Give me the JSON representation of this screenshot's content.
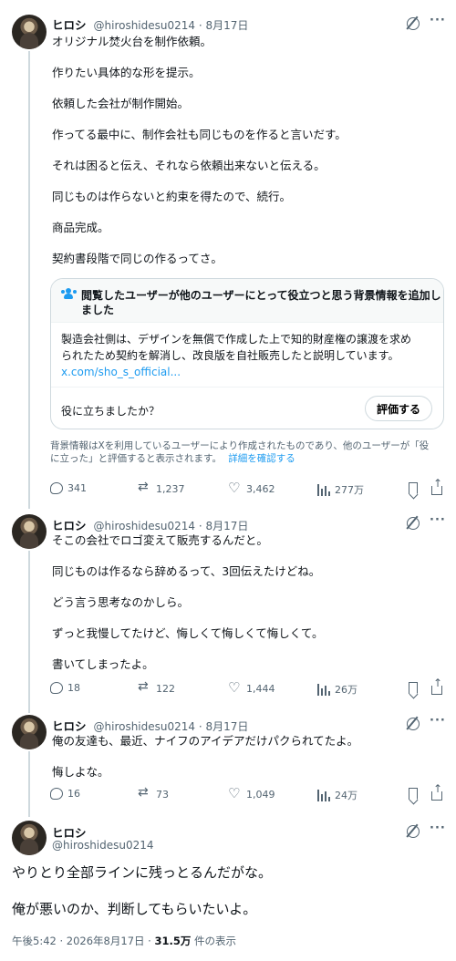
{
  "user": {
    "name": "ヒロシ",
    "handle": "@hiroshidesu0214",
    "sep": "·"
  },
  "tweet1": {
    "date": "8月17日",
    "lines": [
      "オリジナル焚火台を制作依頼。",
      "作りたい具体的な形を提示。",
      "依頼した会社が制作開始。",
      "作ってる最中に、制作会社も同じものを作ると言いだす。",
      "それは困ると伝え、それなら依頼出来ないと伝える。",
      "同じものは作らないと約束を得たので、続行。",
      "商品完成。",
      "契約書段階で同じの作るってさ。"
    ],
    "note": {
      "title_line1": "閲覧したユーザーが他のユーザーにとって役立つと思う背景情報を追加し",
      "title_line2": "ました",
      "body_line1": "製造会社側は、デザインを無償で作成した上で知的財産権の譲渡を求め",
      "body_line2": "られたため契約を解消し、改良版を自社販売したと説明しています。",
      "link": "x.com/sho_s_official...",
      "question": "役に立ちましたか？",
      "rate_button": "評価する"
    },
    "disclaimer_line1": "背景情報はXを利用しているユーザーにより作成されたものであり、他のユーザーが「役",
    "disclaimer_line2": "に立った」と評価すると表示されます。",
    "disclaimer_link": "詳細を確認する",
    "stats": {
      "replies": "341",
      "retweets": "1,237",
      "likes": "3,462",
      "views": "277万"
    }
  },
  "tweet2": {
    "date": "8月17日",
    "lines": [
      "そこの会社でロゴ変えて販売するんだと。",
      "同じものは作るなら辞めるって、3回伝えたけどね。",
      "どう言う思考なのかしら。",
      "ずっと我慢してたけど、悔しくて悔しくて悔しくて。",
      "書いてしまったよ。"
    ],
    "stats": {
      "replies": "18",
      "retweets": "122",
      "likes": "1,444",
      "views": "26万"
    }
  },
  "tweet3": {
    "date": "8月17日",
    "lines": [
      "俺の友達も、最近、ナイフのアイデアだけパクられてたよ。",
      "悔しよな。"
    ],
    "stats": {
      "replies": "16",
      "retweets": "73",
      "likes": "1,049",
      "views": "24万"
    }
  },
  "main": {
    "lines": [
      "やりとり全部ラインに残っとるんだがな。",
      "俺が悪いのか、判断してもらいたいよ。"
    ],
    "timestamp": "午後5:42 · 2026年8月17日 · ",
    "views_count": "31.5万",
    "views_label": " 件の表示"
  },
  "icons": [
    "grok-icon",
    "more-icon",
    "reply-icon",
    "retweet-icon",
    "like-icon",
    "views-icon",
    "bookmark-icon",
    "share-icon",
    "community-notes-icon"
  ],
  "colors": {
    "accent": "#1d9bf0",
    "secondary_text": "#536471",
    "border": "#cfd9de"
  }
}
